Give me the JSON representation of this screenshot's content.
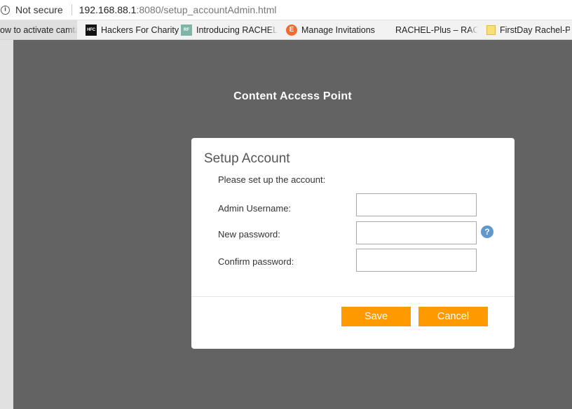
{
  "browser": {
    "security_text": "Not secure",
    "url_host": "192.168.88.1",
    "url_rest": ":8080/setup_accountAdmin.html",
    "info_icon": "info-icon"
  },
  "bookmarks": [
    {
      "label": "ow to activate camta",
      "icon": ""
    },
    {
      "label": "Hackers For Charity",
      "icon": "hfc-icon",
      "icon_text": "HFC"
    },
    {
      "label": "Introducing RACHEL t",
      "icon": "rf-icon",
      "icon_text": "RF"
    },
    {
      "label": "Manage Invitations",
      "icon": "e-icon",
      "icon_text": "E"
    },
    {
      "label": "RACHEL-Plus – RACHE",
      "icon": ""
    },
    {
      "label": "FirstDay Rachel-Plus",
      "icon": "folder-icon"
    }
  ],
  "page": {
    "title": "Content Access Point"
  },
  "dialog": {
    "title": "Setup Account",
    "description": "Please set up the account:",
    "fields": {
      "username_label": "Admin Username:",
      "username_value": "",
      "new_password_label": "New password:",
      "new_password_value": "",
      "confirm_password_label": "Confirm password:",
      "confirm_password_value": ""
    },
    "help_symbol": "?",
    "save_label": "Save",
    "cancel_label": "Cancel"
  },
  "colors": {
    "accent": "#ff9900",
    "page_background": "#636363",
    "help_badge": "#5e98cf"
  }
}
